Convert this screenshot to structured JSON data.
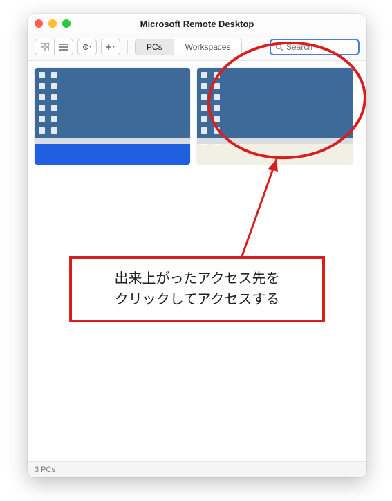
{
  "window": {
    "title": "Microsoft Remote Desktop"
  },
  "toolbar": {
    "tabs": {
      "pcs": "PCs",
      "workspaces": "Workspaces"
    }
  },
  "search": {
    "placeholder": "Search"
  },
  "status": {
    "text": "3 PCs"
  },
  "annotation": {
    "line1": "出来上がったアクセス先を",
    "line2": "クリックしてアクセスする"
  },
  "colors": {
    "accent": "#4a7fd6",
    "annotation": "#d61f1f",
    "desktop": "#3e6a9a"
  }
}
